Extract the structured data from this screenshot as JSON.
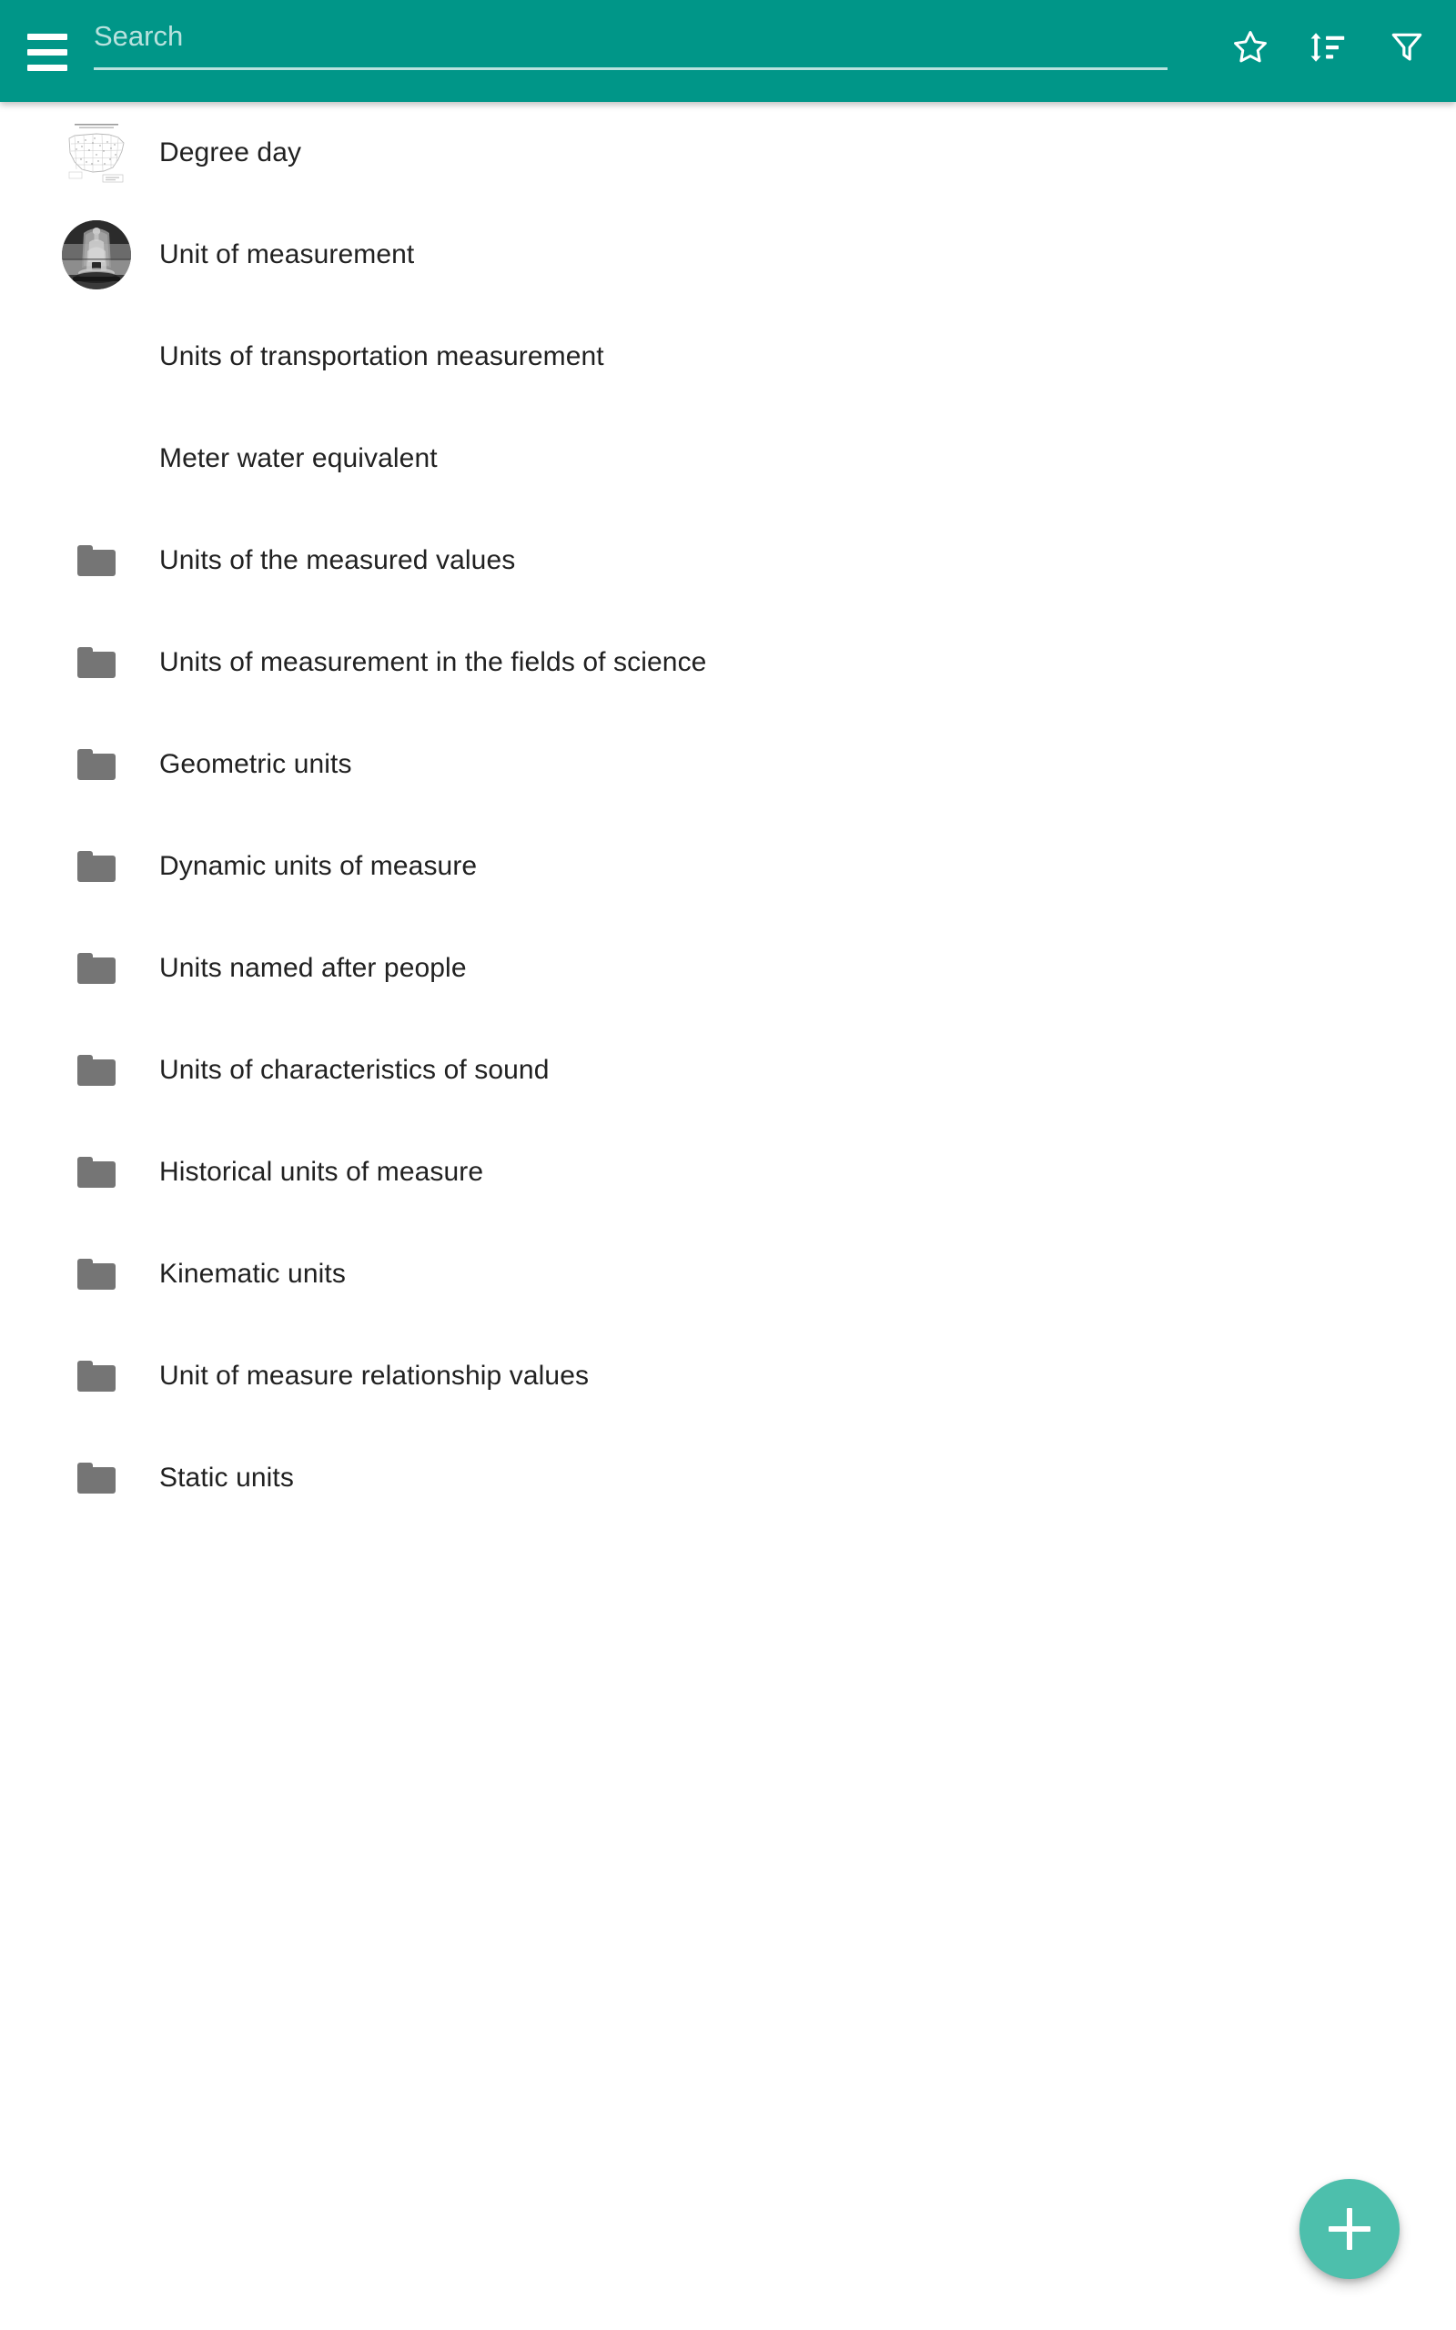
{
  "theme": {
    "appbar_color": "#009688",
    "fab_color": "#4DBFAC",
    "folder_icon_color": "#757575",
    "text_color": "#212121",
    "background": "#ffffff"
  },
  "appbar": {
    "menu_icon": "hamburger-menu-icon",
    "search": {
      "placeholder": "Search",
      "value": ""
    },
    "actions": [
      {
        "name": "favorites-button",
        "icon": "star-outline-icon",
        "label": "Favorites"
      },
      {
        "name": "sort-button",
        "icon": "sort-icon",
        "label": "Sort"
      },
      {
        "name": "filter-button",
        "icon": "filter-funnel-icon",
        "label": "Filter"
      }
    ]
  },
  "list": {
    "items": [
      {
        "label": "Degree day",
        "lead": "thumbnail-map",
        "lead_shape": "square"
      },
      {
        "label": "Unit of measurement",
        "lead": "thumbnail-photo",
        "lead_shape": "circle"
      },
      {
        "label": "Units of transportation measurement",
        "lead": "none",
        "lead_shape": "none"
      },
      {
        "label": "Meter water equivalent",
        "lead": "none",
        "lead_shape": "none"
      },
      {
        "label": "Units of the measured values",
        "lead": "folder-icon",
        "lead_shape": "folder"
      },
      {
        "label": "Units of measurement in the fields of science",
        "lead": "folder-icon",
        "lead_shape": "folder"
      },
      {
        "label": "Geometric units",
        "lead": "folder-icon",
        "lead_shape": "folder"
      },
      {
        "label": "Dynamic units of measure",
        "lead": "folder-icon",
        "lead_shape": "folder"
      },
      {
        "label": "Units named after people",
        "lead": "folder-icon",
        "lead_shape": "folder"
      },
      {
        "label": "Units of characteristics of sound",
        "lead": "folder-icon",
        "lead_shape": "folder"
      },
      {
        "label": "Historical units of measure",
        "lead": "folder-icon",
        "lead_shape": "folder"
      },
      {
        "label": "Kinematic units",
        "lead": "folder-icon",
        "lead_shape": "folder"
      },
      {
        "label": "Unit of measure relationship values",
        "lead": "folder-icon",
        "lead_shape": "folder"
      },
      {
        "label": "Static units",
        "lead": "folder-icon",
        "lead_shape": "folder"
      }
    ]
  },
  "fab": {
    "icon": "plus-icon",
    "label": "Add"
  }
}
